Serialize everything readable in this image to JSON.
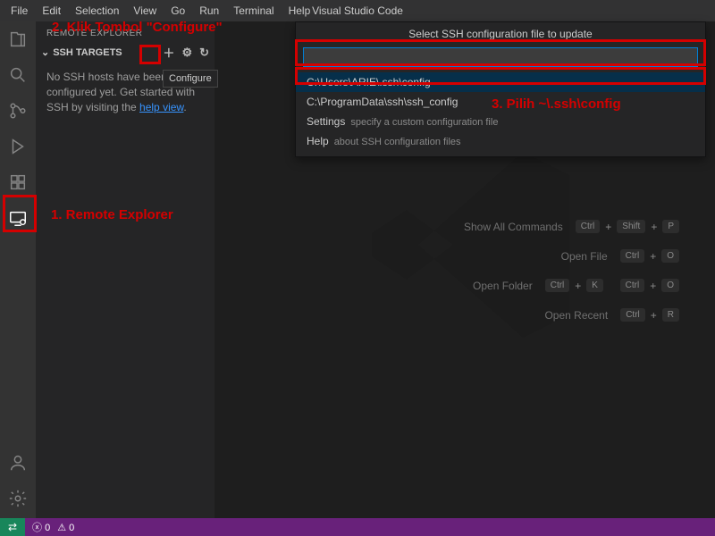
{
  "title": "Visual Studio Code",
  "menu": [
    "File",
    "Edit",
    "Selection",
    "View",
    "Go",
    "Run",
    "Terminal",
    "Help"
  ],
  "sidebar": {
    "panel_title": "REMOTE EXPLORER",
    "section_label": "SSH TARGETS",
    "empty_prefix": "No SSH hosts have been configured yet. Get started with SSH by visiting the ",
    "empty_link": "help view",
    "empty_suffix": "."
  },
  "tooltip": {
    "configure": "Configure"
  },
  "quickpick": {
    "title": "Select SSH configuration file to update",
    "items": [
      {
        "label": "C:\\Users\\ARIE\\.ssh\\config",
        "hint": ""
      },
      {
        "label": "C:\\ProgramData\\ssh\\ssh_config",
        "hint": ""
      },
      {
        "label": "Settings",
        "hint": "specify a custom configuration file"
      },
      {
        "label": "Help",
        "hint": "about SSH configuration files"
      }
    ]
  },
  "watermark": {
    "show_all": "Show All Commands",
    "open_file": "Open File",
    "open_folder": "Open Folder",
    "open_recent": "Open Recent",
    "keys": {
      "ctrl": "Ctrl",
      "shift": "Shift",
      "plus": "+",
      "p": "P",
      "o": "O",
      "k": "K",
      "r": "R"
    }
  },
  "statusbar": {
    "errors": "0",
    "warnings": "0"
  },
  "annotations": {
    "a1": "1. Remote Explorer",
    "a2": "2. Klik Tombol \"Configure\"",
    "a3": "3. Pilih ~\\.ssh\\config"
  },
  "icons": {
    "explorer": "explorer-icon",
    "search": "search-icon",
    "scm": "scm-icon",
    "run": "run-icon",
    "ext": "extensions-icon",
    "remote": "remote-explorer-icon",
    "account": "account-icon",
    "gear": "gear-icon"
  }
}
